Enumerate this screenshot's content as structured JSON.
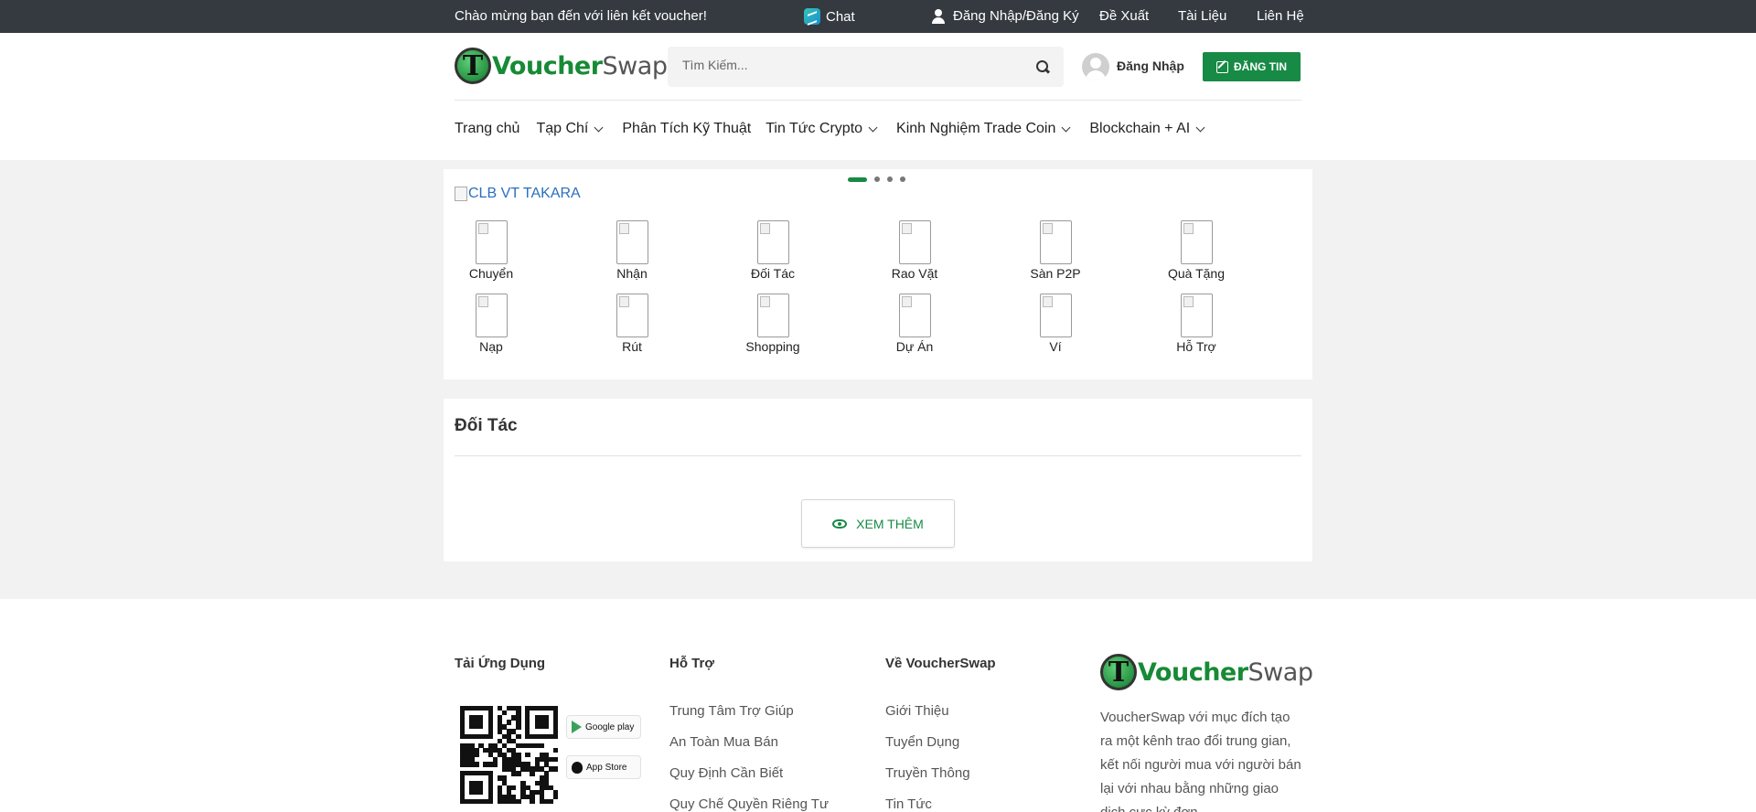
{
  "topbar": {
    "welcome": "Chào mừng bạn đến với liên kết voucher!",
    "chat": "Chat",
    "login": "Đăng Nhập/Đăng Ký",
    "links": [
      "Đề Xuất",
      "Tài Liệu",
      "Liên Hệ"
    ]
  },
  "header": {
    "logo_t": "T",
    "logo_word_1": "Voucher",
    "logo_word_2": "Swap",
    "search_placeholder": "Tìm Kiếm...",
    "login": "Đăng Nhập",
    "post_button": "ĐĂNG TIN"
  },
  "nav": [
    {
      "label": "Trang chủ",
      "dropdown": false
    },
    {
      "label": "Tạp Chí",
      "dropdown": true
    },
    {
      "label": "Phân Tích Kỹ Thuật",
      "dropdown": false
    },
    {
      "label": "Tin Tức Crypto",
      "dropdown": true
    },
    {
      "label": "Kinh Nghiệm Trade Coin",
      "dropdown": true
    },
    {
      "label": "Blockchain + AI",
      "dropdown": true
    }
  ],
  "banner": {
    "alt_text": "CLB VT TAKARA",
    "slides": 4,
    "active_slide": 1
  },
  "services": [
    "Chuyển",
    "Nhận",
    "Đối Tác",
    "Rao Vặt",
    "Sàn P2P",
    "Quà Tặng",
    "Nạp",
    "Rút",
    "Shopping",
    "Dự Án",
    "Ví",
    "Hỗ Trợ"
  ],
  "partners": {
    "title": "Đối Tác",
    "more_button": "XEM THÊM"
  },
  "footer": {
    "app_title": "Tải Ứng Dụng",
    "google_play": "Google play",
    "app_store": "App Store",
    "support_title": "Hỗ Trợ",
    "support_links": [
      "Trung Tâm Trợ Giúp",
      "An Toàn Mua Bán",
      "Quy Định Cần Biết",
      "Quy Chế Quyền Riêng Tư"
    ],
    "about_title": "Về VoucherSwap",
    "about_links": [
      "Giới Thiệu",
      "Tuyển Dụng",
      "Truyền Thông",
      "Tin Tức"
    ],
    "description": "VoucherSwap với mục đích tạo ra một kênh trao đổi trung gian, kết nối người mua với người bán lại với nhau bằng những giao dịch cực kỳ đơn"
  },
  "colors": {
    "brand_green": "#178a45",
    "topbar_bg": "#343a40",
    "link_blue": "#2a6fbf"
  }
}
